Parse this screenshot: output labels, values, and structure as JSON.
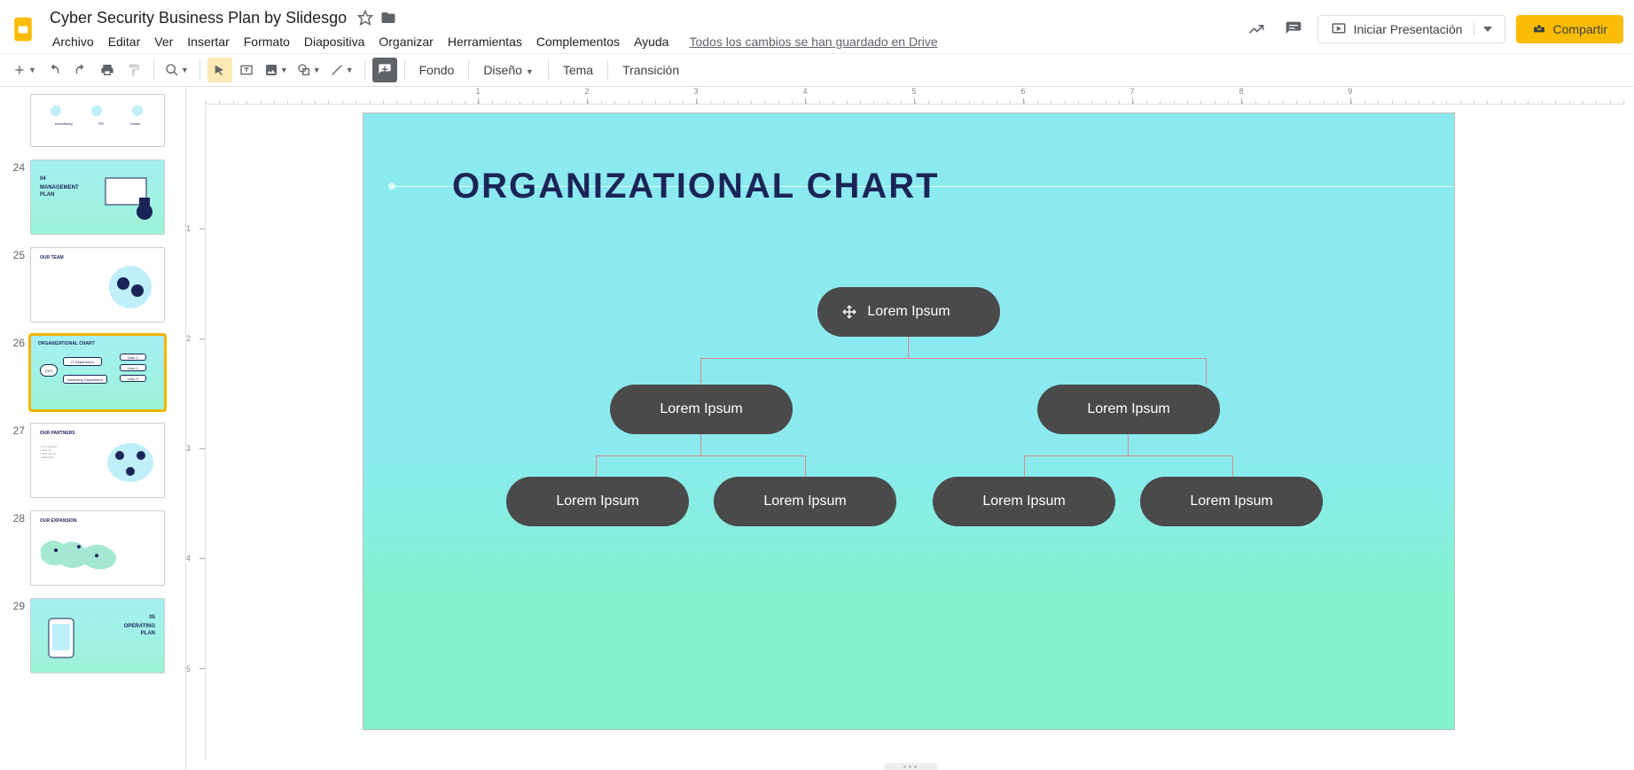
{
  "header": {
    "doc_title": "Cyber Security Business Plan by Slidesgo",
    "save_status": "Todos los cambios se han guardado en Drive",
    "present_label": "Iniciar Presentación",
    "share_label": "Compartir",
    "menus": [
      "Archivo",
      "Editar",
      "Ver",
      "Insertar",
      "Formato",
      "Diapositiva",
      "Organizar",
      "Herramientas",
      "Complementos",
      "Ayuda"
    ]
  },
  "toolbar": {
    "background_label": "Fondo",
    "layout_label": "Diseño",
    "theme_label": "Tema",
    "transition_label": "Transición"
  },
  "thumbnails": {
    "items": [
      {
        "num": "",
        "title": ""
      },
      {
        "num": "24",
        "title": "04 MANAGEMENT PLAN"
      },
      {
        "num": "25",
        "title": "OUR TEAM"
      },
      {
        "num": "26",
        "title": "ORGANIZATIONAL CHART"
      },
      {
        "num": "27",
        "title": "OUR PARTNERS"
      },
      {
        "num": "28",
        "title": "OUR EXPANSION"
      },
      {
        "num": "29",
        "title": "05 OPERATING PLAN"
      }
    ]
  },
  "slide": {
    "title": "ORGANIZATIONAL CHART",
    "nodes": {
      "root": "Lorem Ipsum",
      "l2a": "Lorem Ipsum",
      "l2b": "Lorem Ipsum",
      "l3a": "Lorem Ipsum",
      "l3b": "Lorem Ipsum",
      "l3c": "Lorem Ipsum",
      "l3d": "Lorem Ipsum"
    }
  },
  "ruler": {
    "h_labels": [
      "1",
      "2",
      "3",
      "4",
      "5",
      "6",
      "7",
      "8",
      "9"
    ],
    "v_labels": [
      "1",
      "2",
      "3",
      "4",
      "5"
    ]
  },
  "chart_data": {
    "type": "org_chart",
    "title": "ORGANIZATIONAL CHART",
    "tree": {
      "label": "Lorem Ipsum",
      "children": [
        {
          "label": "Lorem Ipsum",
          "children": [
            {
              "label": "Lorem Ipsum"
            },
            {
              "label": "Lorem Ipsum"
            }
          ]
        },
        {
          "label": "Lorem Ipsum",
          "children": [
            {
              "label": "Lorem Ipsum"
            },
            {
              "label": "Lorem Ipsum"
            }
          ]
        }
      ]
    }
  }
}
